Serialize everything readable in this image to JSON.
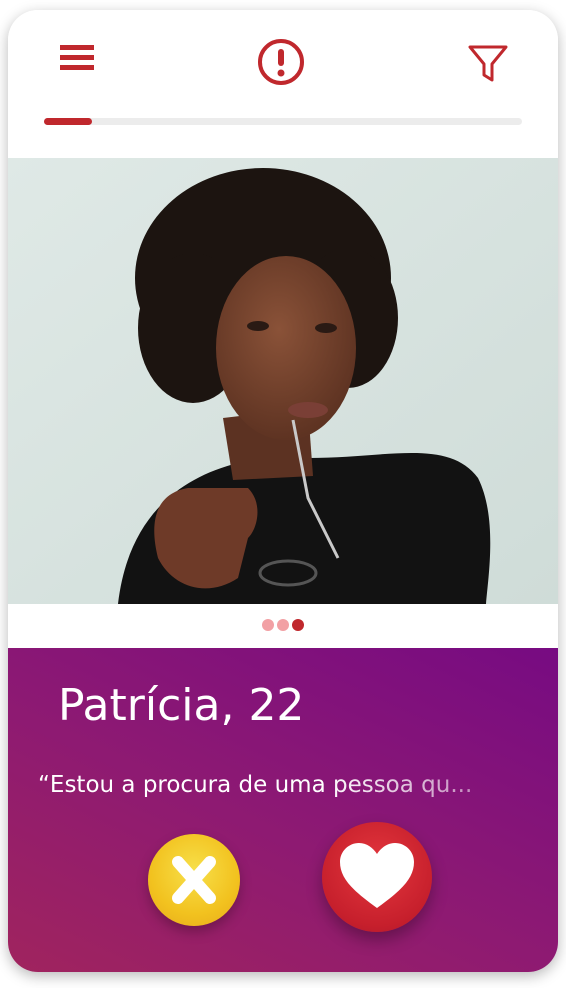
{
  "header": {
    "menu_icon": "hamburger-menu-icon",
    "alert_icon": "exclamation-circle-icon",
    "filter_icon": "funnel-filter-icon",
    "progress": 0.1
  },
  "profile": {
    "name": "Patrícia",
    "age_text": ", 22",
    "bio": "“Estou a procura de uma pessoa qu..."
  },
  "photo_pager": {
    "total": 3,
    "active_index": 2
  },
  "actions": {
    "dislike_icon": "x-icon",
    "like_icon": "heart-icon"
  },
  "colors": {
    "brand_red": "#c0282d",
    "panel_purple": "#8e1a72",
    "dislike_yellow": "#f2c21f",
    "like_red": "#c61f2c",
    "dot_inactive": "#f2a0a4",
    "dot_active": "#c0282d"
  }
}
